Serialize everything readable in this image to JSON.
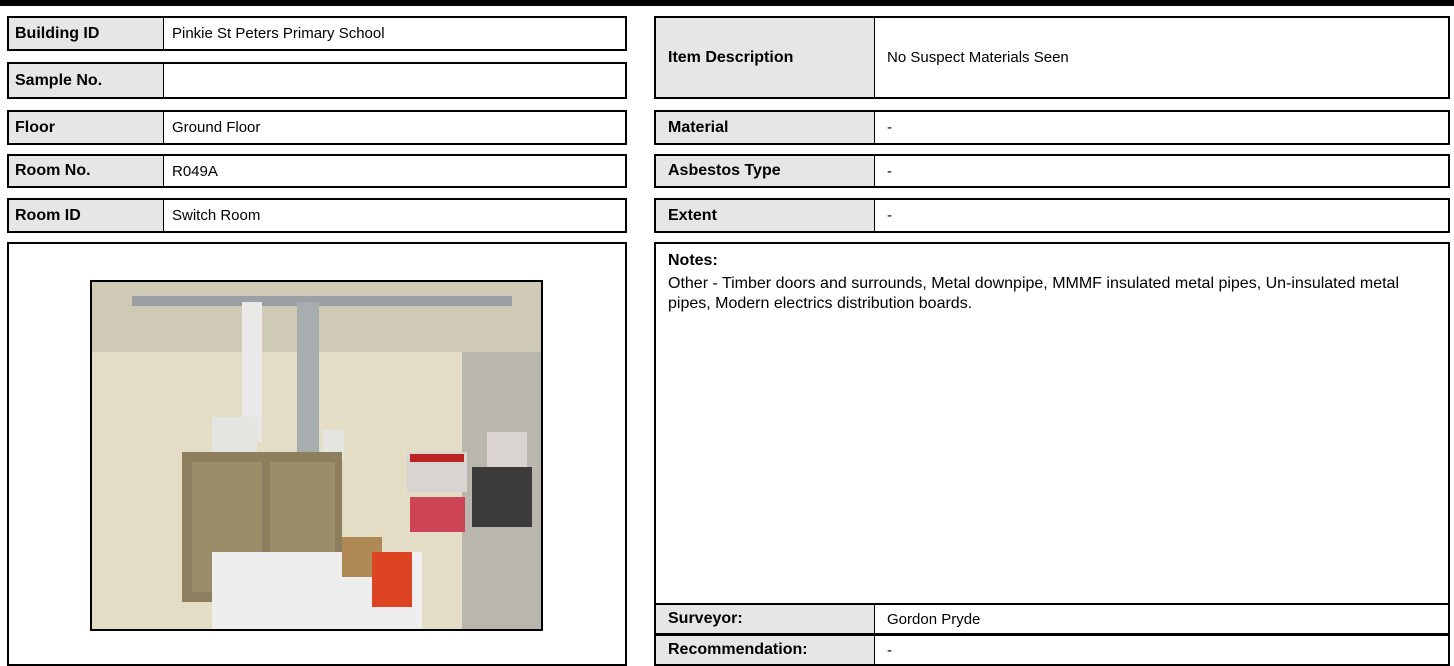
{
  "left": {
    "building_id_label": "Building ID",
    "building_id_value": "Pinkie St Peters Primary School",
    "sample_no_label": "Sample No.",
    "sample_no_value": "",
    "floor_label": "Floor",
    "floor_value": "Ground Floor",
    "room_no_label": "Room No.",
    "room_no_value": "R049A",
    "room_id_label": "Room ID",
    "room_id_value": "Switch Room"
  },
  "right": {
    "item_description_label": "Item Description",
    "item_description_value": "No Suspect Materials Seen",
    "material_label": "Material",
    "material_value": "-",
    "asbestos_type_label": "Asbestos Type",
    "asbestos_type_value": "-",
    "extent_label": "Extent",
    "extent_value": "-",
    "notes_label": "Notes:",
    "notes_text": "Other - Timber doors and surrounds, Metal downpipe, MMMF insulated metal pipes, Un-insulated metal pipes, Modern electrics distribution boards.",
    "surveyor_label": "Surveyor:",
    "surveyor_value": "Gordon Pryde",
    "recommendation_label": "Recommendation:",
    "recommendation_value": "-"
  }
}
